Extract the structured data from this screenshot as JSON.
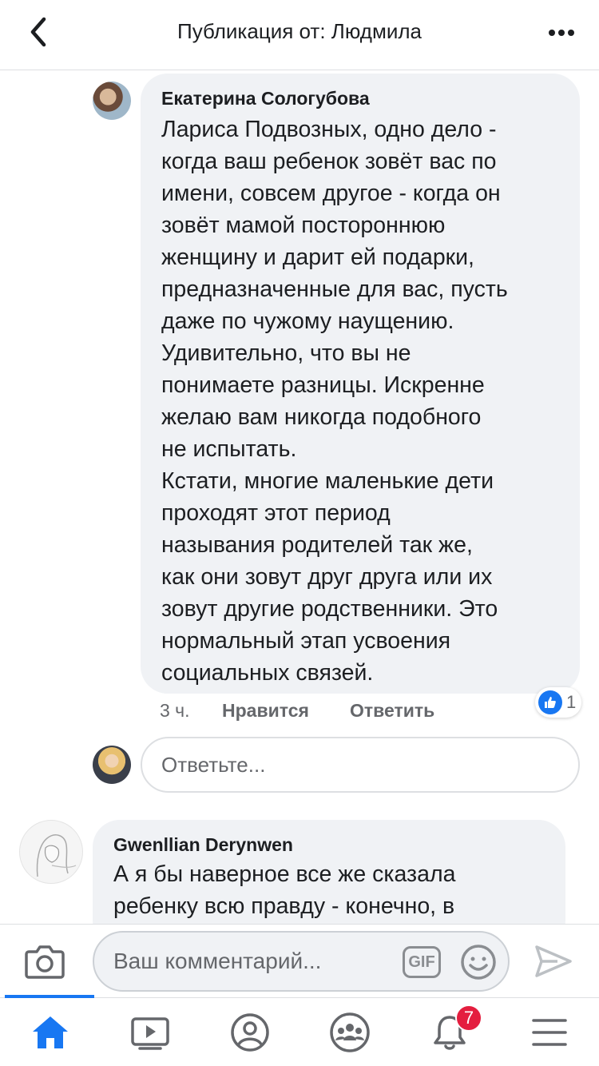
{
  "header": {
    "title": "Публикация от: Людмила"
  },
  "comments": [
    {
      "author": "Екатерина Сологубова",
      "text": "Лариса Подвозных, одно дело -\nкогда ваш ребенок зовёт вас по\nимени, совсем другое - когда он\nзовёт мамой постороннюю\nженщину и дарит ей подарки,\nпредназначенные для вас, пусть\nдаже по чужому наущению.\nУдивительно, что вы не\nпонимаете разницы. Искренне\nжелаю вам никогда подобного\nне испытать.\nКстати, многие маленькие дети\nпроходят этот период\nназывания родителей так же,\nкак они зовут друг друга или их\nзовут другие родственники. Это\nнормальный этап усвоения\nсоциальных связей.",
      "time": "3 ч.",
      "like_label": "Нравится",
      "reply_label": "Ответить",
      "reaction_count": "1"
    },
    {
      "author": "Gwenllian Derynwen",
      "text": "А я бы наверное все же сказала\nребенку всю правду - конечно, в"
    }
  ],
  "reply_input": {
    "placeholder": "Ответьте..."
  },
  "composer": {
    "placeholder": "Ваш комментарий...",
    "gif_label": "GIF"
  },
  "tabbar": {
    "notifications_badge": "7"
  },
  "colors": {
    "accent": "#1877f2",
    "badge": "#e41e3f",
    "bubble": "#f0f2f5",
    "secondary_text": "#65676b"
  }
}
